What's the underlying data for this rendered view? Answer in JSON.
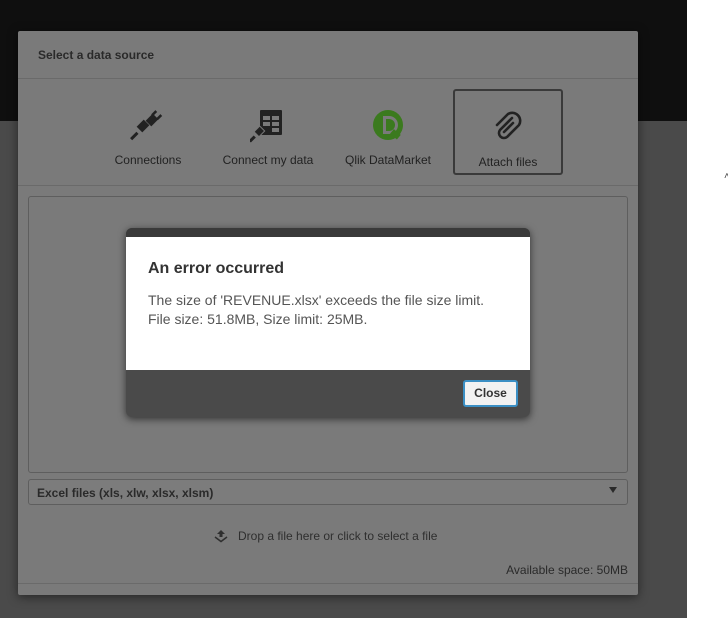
{
  "dialog": {
    "title": "Select a data source",
    "sources": [
      {
        "label": "Connections",
        "icon": "plug-icon"
      },
      {
        "label": "Connect my data",
        "icon": "table-plug-icon"
      },
      {
        "label": "Qlik DataMarket",
        "icon": "qlik-datamarket-icon"
      },
      {
        "label": "Attach files",
        "icon": "paperclip-icon",
        "selected": true
      }
    ],
    "file_type": {
      "selected": "Excel files (xls, xlw, xlsx, xlsm)",
      "icon": "chevron-down-icon"
    },
    "drop_hint": {
      "icon": "upload-icon",
      "text": "Drop a file here or click to select a file"
    },
    "available_space": "Available space: 50MB"
  },
  "error": {
    "title": "An error occurred",
    "line1": "The size of 'REVENUE.xlsx' exceeds the file size limit.",
    "line2": "File size: 51.8MB, Size limit: 25MB.",
    "close_label": "Close"
  },
  "colors": {
    "overlay": "#4a4a4a",
    "top_bar": "#0f0f0f",
    "qlik_green": "#3b7a1e",
    "focus_blue": "#3b8fc4"
  }
}
